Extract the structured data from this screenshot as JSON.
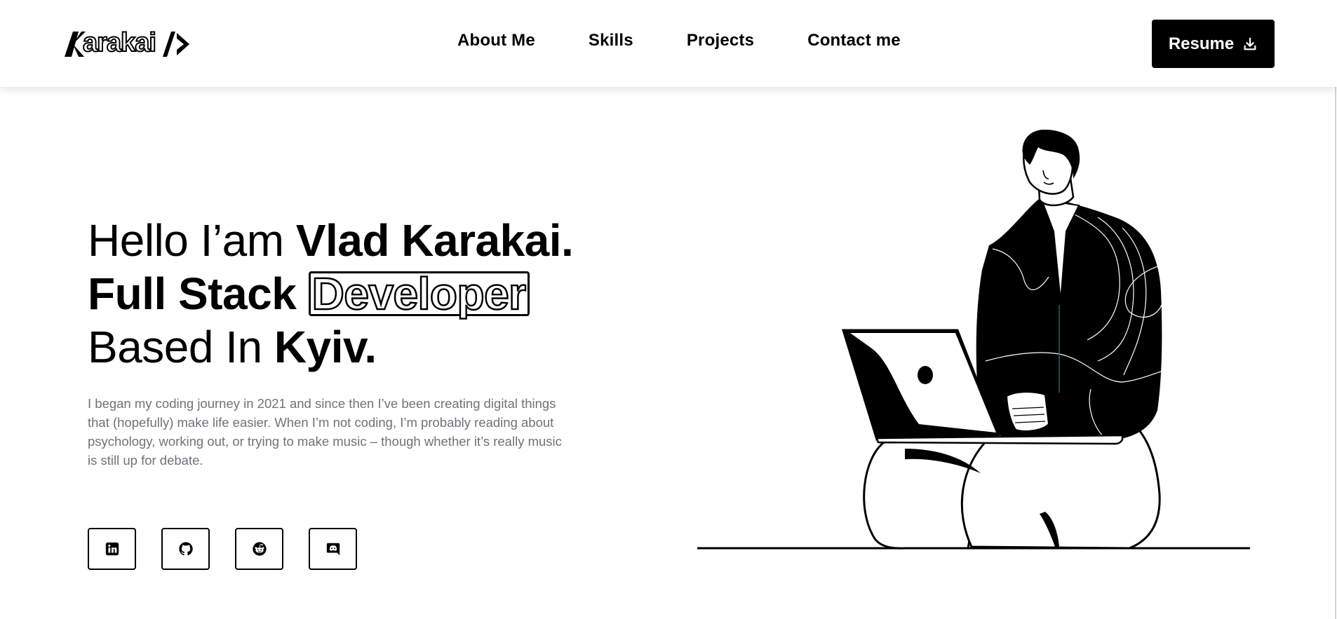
{
  "brand": {
    "logo_text": "arakai"
  },
  "nav": {
    "items": [
      {
        "label": "About Me"
      },
      {
        "label": "Skills"
      },
      {
        "label": "Projects"
      },
      {
        "label": "Contact me"
      }
    ],
    "resume_label": "Resume"
  },
  "hero": {
    "line1_light": "Hello I’am ",
    "line1_bold": "Vlad Karakai.",
    "line2_bold": "Full Stack ",
    "line2_outline": "Developer",
    "line3_light": "Based In ",
    "line3_bold": "Kyiv.",
    "intro": "I began my coding journey in 2021 and since then I’ve been creating digital things that (hopefully) make life easier. When I’m not coding, I’m probably reading about psychology, working out, or trying to make music – though whether it’s really music is still up for debate."
  },
  "socials": [
    {
      "icon": "linkedin-icon"
    },
    {
      "icon": "github-icon"
    },
    {
      "icon": "reddit-icon"
    },
    {
      "icon": "discord-icon"
    }
  ],
  "colors": {
    "accent": "#000000",
    "muted_text": "#71717a",
    "background": "#ffffff"
  }
}
